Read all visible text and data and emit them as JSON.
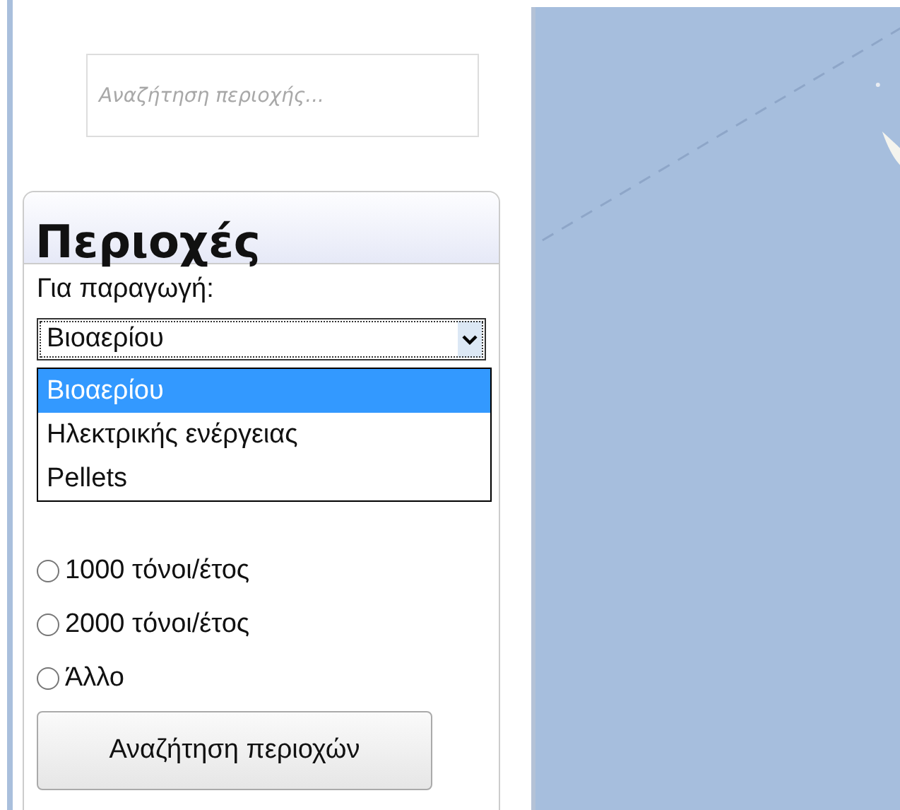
{
  "search": {
    "placeholder": "Αναζήτηση περιοχής..."
  },
  "panel": {
    "title": "Περιοχές",
    "production_label": "Για παραγωγή:",
    "select": {
      "value": "Βιοαερίου",
      "expanded": true,
      "options": [
        {
          "label": "Βιοαερίου",
          "selected": true
        },
        {
          "label": "Ηλεκτρικής ενέργειας",
          "selected": false
        },
        {
          "label": "Pellets",
          "selected": false
        }
      ]
    },
    "radios": [
      {
        "label": "1000 τόνοι/έτος",
        "selected": false
      },
      {
        "label": "2000 τόνοι/έτος",
        "selected": false
      },
      {
        "label": "Άλλο",
        "selected": false
      }
    ],
    "button": "Αναζήτηση περιοχών"
  }
}
